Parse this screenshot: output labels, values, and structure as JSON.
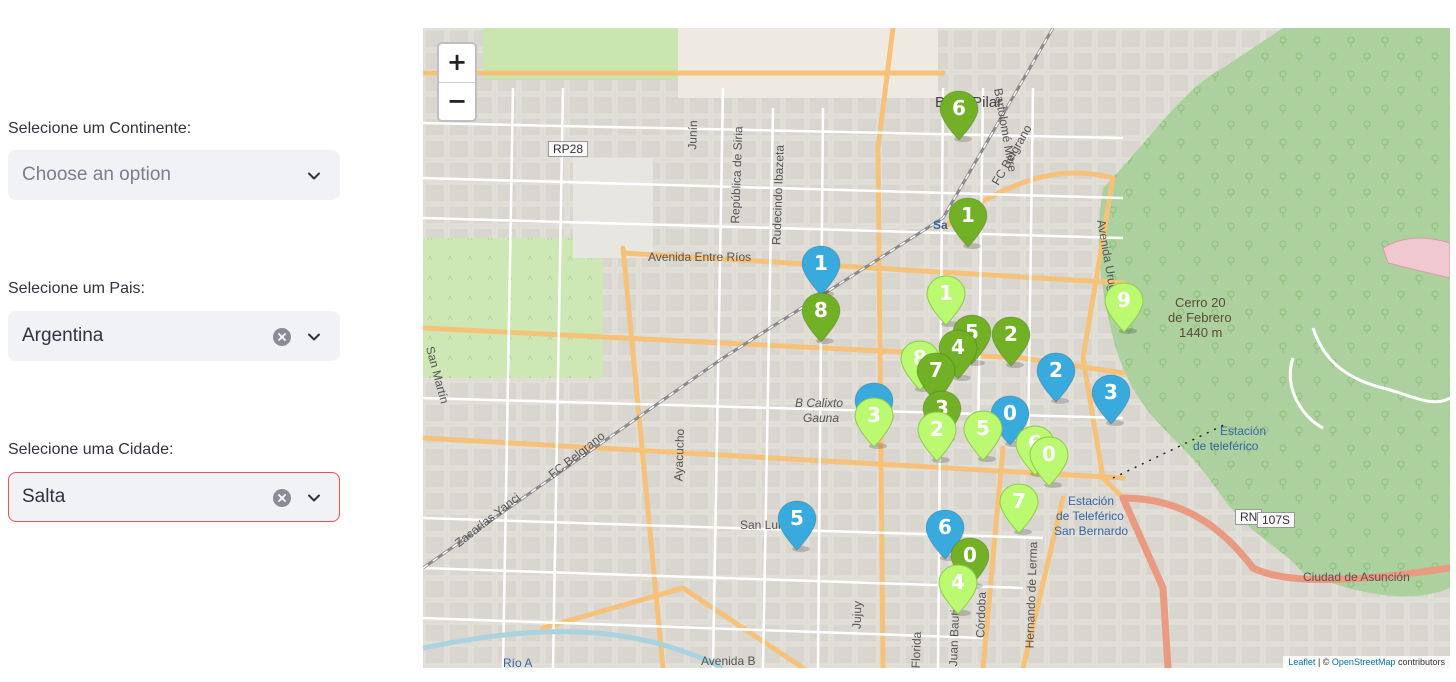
{
  "sidebar": {
    "continent": {
      "label": "Selecione um Continente:",
      "value": "Choose an option"
    },
    "country": {
      "label": "Selecione um Pais:",
      "value": "Argentina"
    },
    "city": {
      "label": "Selecione uma Cidade:",
      "value": "Salta"
    }
  },
  "map": {
    "zoom_in": "+",
    "zoom_out": "−",
    "labels": {
      "pilar": "Bº El Pilar",
      "rp28": "RP28",
      "entre_rios": "Avenida Entre Ríos",
      "cerro": "Cerro 20",
      "cerro2": "de Febrero",
      "cerro3": "1440 m",
      "calixto": "B Calixto",
      "calixto2": "Gauna",
      "estacion_tel": "Estación",
      "estacion_tel2": "de teleférico",
      "estacion_sb": "Estación",
      "estacion_sb2": "de Teleférico",
      "estacion_sb3": "San Bernardo",
      "asuncion": "Ciudad de Asunción",
      "rn": "RN",
      "r107": "107S",
      "fc_belgrano": "FC Belgrano",
      "zacarias": "Zacarías Yanci",
      "san_luis": "San Luis",
      "jujuy": "Jujuy",
      "cordoba": "Córdoba",
      "hernando": "Hernando de Lerma",
      "ayacucho": "Ayacucho",
      "siria": "República de Siria",
      "ibazeta": "Rudecindo Ibazeta",
      "junin": "Junín",
      "uruguay": "Avenida Uruguay",
      "bartolome": "Bartolomé Mitre",
      "martin": "San Martín",
      "florida": "Florida",
      "juanb": "Juan Bautista",
      "belgrano_ne": "FC Belgrano",
      "avenida_b": "Avenida B",
      "rio": "Río A",
      "salta_lbl": "Sa"
    },
    "attribution": {
      "leaflet": "Leaflet",
      "sep": " | © ",
      "osm": "OpenStreetMap",
      "contrib": " contributors"
    },
    "markers": [
      {
        "n": "6",
        "color": "#72b026"
      },
      {
        "n": "1",
        "color": "#72b026"
      },
      {
        "n": "1",
        "color": "#38aadd"
      },
      {
        "n": "8",
        "color": "#72b026"
      },
      {
        "n": "1",
        "color": "#bbf970"
      },
      {
        "n": "9",
        "color": "#bbf970"
      },
      {
        "n": "5",
        "color": "#72b026"
      },
      {
        "n": "4",
        "color": "#72b026"
      },
      {
        "n": "2",
        "color": "#72b026"
      },
      {
        "n": "8",
        "color": "#bbf970"
      },
      {
        "n": "7",
        "color": "#72b026"
      },
      {
        "n": "2",
        "color": "#38aadd"
      },
      {
        "n": "3",
        "color": "#38aadd"
      },
      {
        "n": "",
        "color": "#38aadd"
      },
      {
        "n": "3",
        "color": "#bbf970"
      },
      {
        "n": "3",
        "color": "#72b026"
      },
      {
        "n": "0",
        "color": "#38aadd"
      },
      {
        "n": "2",
        "color": "#bbf970"
      },
      {
        "n": "5",
        "color": "#bbf970"
      },
      {
        "n": "6",
        "color": "#bbf970"
      },
      {
        "n": "0",
        "color": "#bbf970"
      },
      {
        "n": "7",
        "color": "#bbf970"
      },
      {
        "n": "5",
        "color": "#38aadd"
      },
      {
        "n": "6",
        "color": "#38aadd"
      },
      {
        "n": "0",
        "color": "#72b026"
      },
      {
        "n": "4",
        "color": "#bbf970"
      }
    ]
  }
}
